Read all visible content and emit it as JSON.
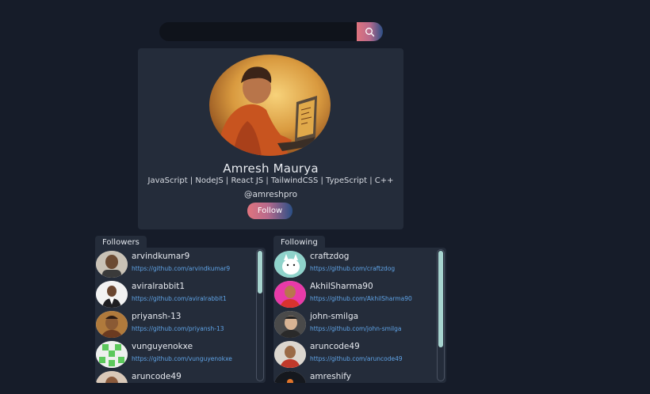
{
  "search": {
    "placeholder": "",
    "value": "",
    "button_icon": "search-icon"
  },
  "profile": {
    "name": "Amresh Maurya",
    "bio": "JavaScript | NodeJS | React JS | TailwindCSS | TypeScript | C++",
    "handle": "@amreshpro",
    "follow_label": "Follow"
  },
  "followers": {
    "title": "Followers",
    "items": [
      {
        "name": "arvindkumar9",
        "url": "https://github.com/arvindkumar9"
      },
      {
        "name": "aviralrabbit1",
        "url": "https://github.com/aviralrabbit1"
      },
      {
        "name": "priyansh-13",
        "url": "https://github.com/priyansh-13"
      },
      {
        "name": "vunguyenokxe",
        "url": "https://github.com/vunguyenokxe"
      },
      {
        "name": "aruncode49",
        "url": ""
      }
    ]
  },
  "following": {
    "title": "Following",
    "items": [
      {
        "name": "craftzdog",
        "url": "https://github.com/craftzdog"
      },
      {
        "name": "AkhilSharma90",
        "url": "https://github.com/AkhilSharma90"
      },
      {
        "name": "john-smilga",
        "url": "https://github.com/john-smilga"
      },
      {
        "name": "aruncode49",
        "url": "https://github.com/aruncode49"
      },
      {
        "name": "amreshify",
        "url": ""
      }
    ]
  },
  "colors": {
    "background": "#161c29",
    "card": "#242c3a",
    "link": "#5fa3e6",
    "accent_pink": "#e0747e",
    "accent_blue": "#2a4f86",
    "scroll_thumb": "#a7d4cf"
  }
}
